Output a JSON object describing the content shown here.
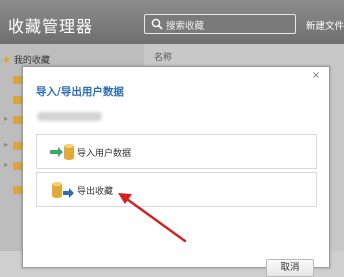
{
  "app": {
    "title": "收藏管理器",
    "search_placeholder": "搜索收藏",
    "new_folder_label": "新建文件夹"
  },
  "sidebar": {
    "root_label": "我的收藏",
    "folder_rows": 6
  },
  "list": {
    "column_name": "名称"
  },
  "dialog": {
    "title": "导入/导出用户数据",
    "close_glyph": "×",
    "actions": [
      {
        "label": "导入用户数据",
        "icon": "import-icon"
      },
      {
        "label": "导出收藏",
        "icon": "export-icon"
      }
    ],
    "cancel_label": "取消"
  },
  "colors": {
    "titlebar": "#7a7a7a",
    "dialog_title": "#2f6db5",
    "annotation_arrow": "#d42020",
    "import_arrow": "#3aa66a",
    "export_arrow": "#2f6db5",
    "db_icon": "#e0a93c"
  }
}
